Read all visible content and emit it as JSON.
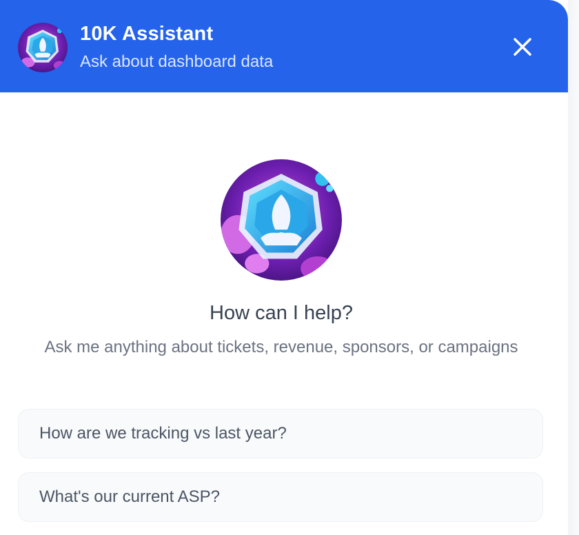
{
  "header": {
    "title": "10K Assistant",
    "subtitle": "Ask about dashboard data",
    "close_icon": "close-icon",
    "avatar_icon": "rocket-badge-avatar",
    "background": "#2563eb"
  },
  "welcome": {
    "heading": "How can I help?",
    "subtext": "Ask me anything about tickets, revenue, sponsors, or campaigns"
  },
  "suggestions": [
    {
      "label": "How are we tracking vs last year?"
    },
    {
      "label": "What's our current ASP?"
    }
  ],
  "colors": {
    "accent": "#2563eb",
    "avatar_purple": "#7c2cc9",
    "avatar_teal": "#22b8e8"
  }
}
